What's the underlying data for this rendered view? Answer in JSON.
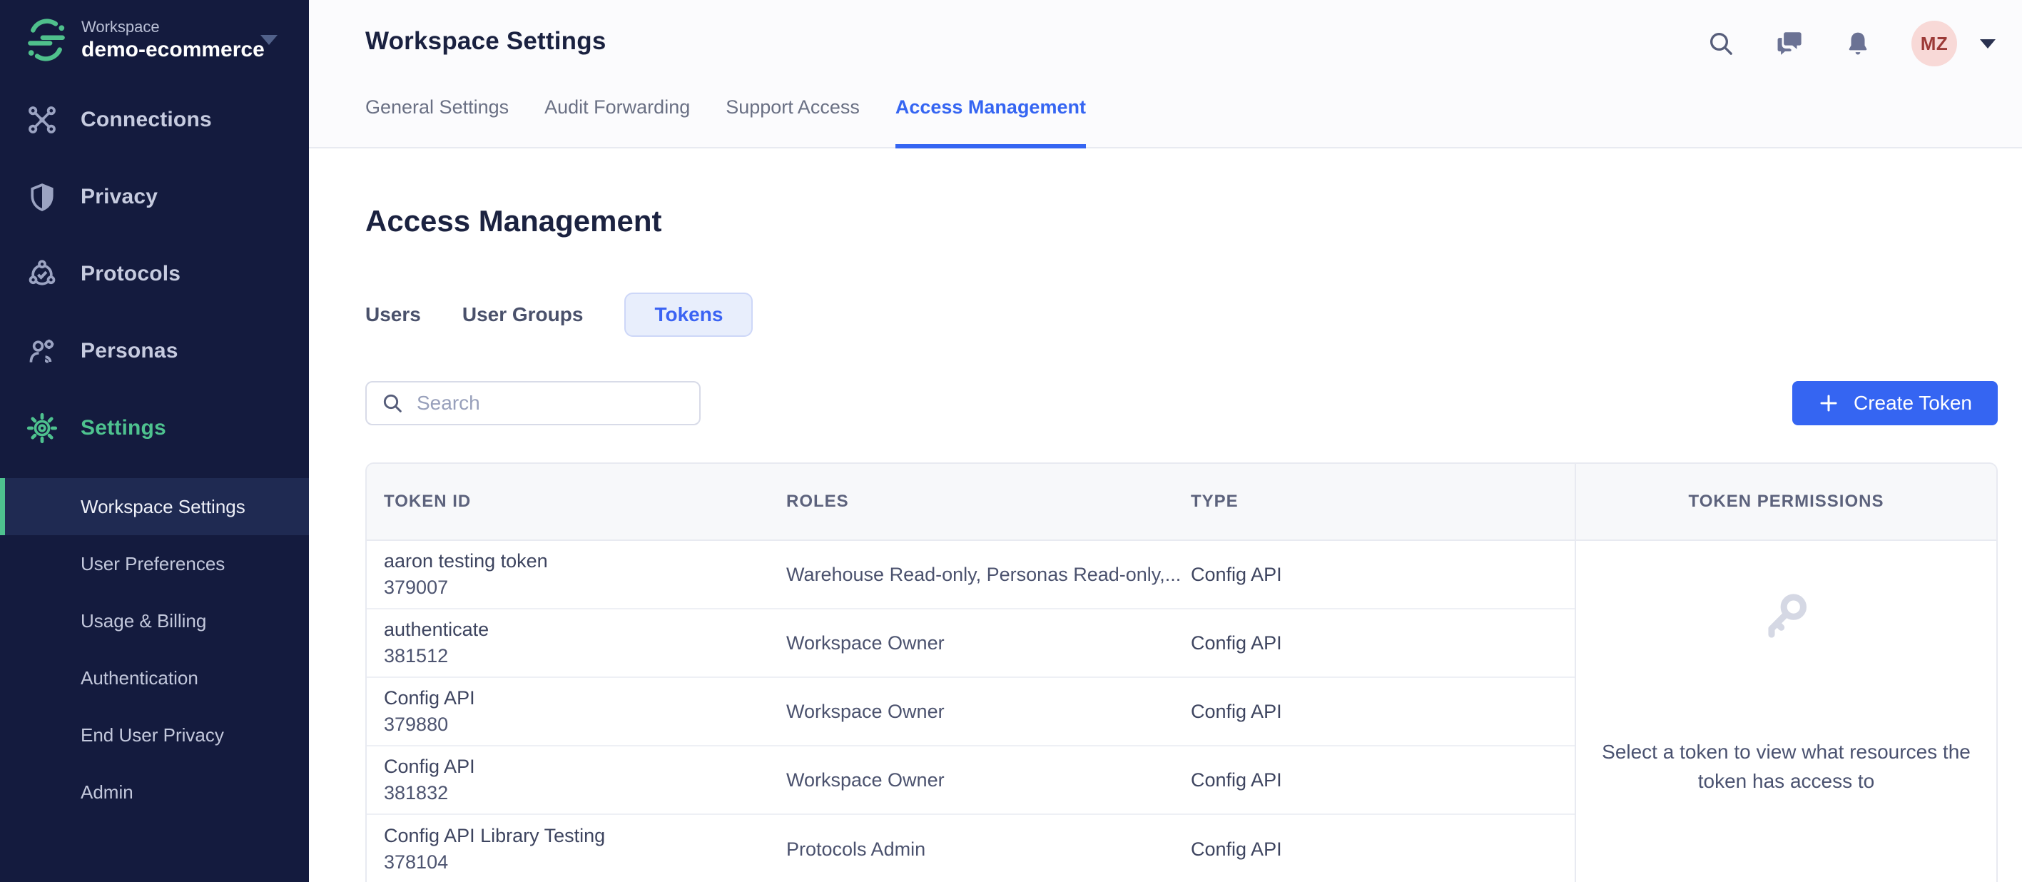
{
  "colors": {
    "sidebar_bg": "#141b3e",
    "sidebar_active_bg": "#1f2a52",
    "accent_green": "#4ec28f",
    "accent_blue": "#3565f2",
    "avatar_bg": "#f8d9d7",
    "avatar_text": "#9c3a37",
    "header_bg": "#fbfbfd",
    "table_header_bg": "#f7f8fa"
  },
  "sidebar": {
    "workspace_label": "Workspace",
    "workspace_name": "demo-ecommerce",
    "items": [
      {
        "label": "Connections",
        "icon": "connections-icon"
      },
      {
        "label": "Privacy",
        "icon": "shield-icon"
      },
      {
        "label": "Protocols",
        "icon": "protocols-icon"
      },
      {
        "label": "Personas",
        "icon": "personas-icon"
      },
      {
        "label": "Settings",
        "icon": "gear-icon",
        "active": true
      }
    ],
    "sub_items": [
      {
        "label": "Workspace Settings",
        "active": true
      },
      {
        "label": "User Preferences"
      },
      {
        "label": "Usage & Billing"
      },
      {
        "label": "Authentication"
      },
      {
        "label": "End User Privacy"
      },
      {
        "label": "Admin"
      }
    ]
  },
  "header": {
    "title": "Workspace Settings",
    "tabs": [
      {
        "label": "General Settings"
      },
      {
        "label": "Audit Forwarding"
      },
      {
        "label": "Support Access"
      },
      {
        "label": "Access Management",
        "active": true
      }
    ],
    "icons": [
      "search-icon",
      "chat-icon",
      "bell-icon"
    ],
    "avatar_initials": "MZ"
  },
  "main": {
    "heading": "Access Management",
    "tabs": [
      {
        "label": "Users"
      },
      {
        "label": "User Groups"
      },
      {
        "label": "Tokens",
        "active": true
      }
    ],
    "search": {
      "placeholder": "Search"
    },
    "create_button_label": "Create Token",
    "table": {
      "columns": [
        "Token ID",
        "Roles",
        "Type"
      ],
      "rows": [
        {
          "name": "aaron testing token",
          "id": "379007",
          "roles": "Warehouse Read-only, Personas Read-only,...",
          "type": "Config API"
        },
        {
          "name": "authenticate",
          "id": "381512",
          "roles": "Workspace Owner",
          "type": "Config API"
        },
        {
          "name": "Config API",
          "id": "379880",
          "roles": "Workspace Owner",
          "type": "Config API"
        },
        {
          "name": "Config API",
          "id": "381832",
          "roles": "Workspace Owner",
          "type": "Config API"
        },
        {
          "name": "Config API Library Testing",
          "id": "378104",
          "roles": "Protocols Admin",
          "type": "Config API"
        }
      ]
    },
    "panel": {
      "header": "Token Permissions",
      "empty_icon": "key-icon",
      "message": "Select a token to view what resources the token has access to"
    }
  }
}
